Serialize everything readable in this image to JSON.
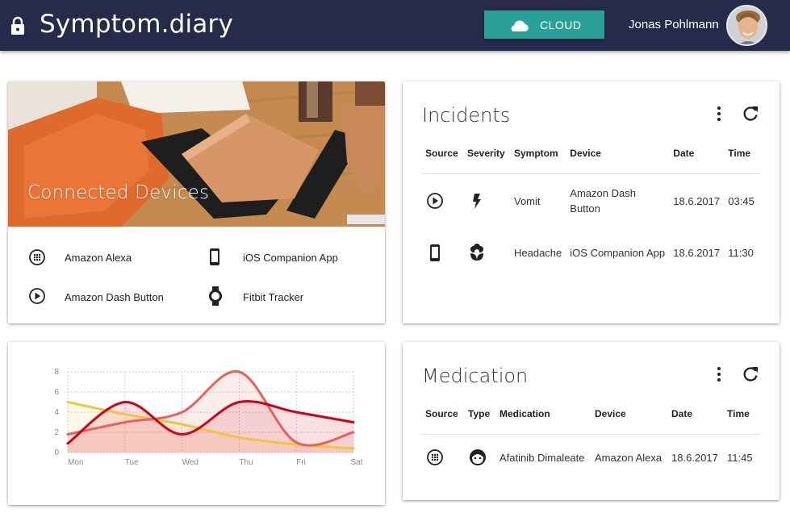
{
  "header": {
    "title": "Symptom.diary",
    "cloud_label": "CLOUD",
    "user_name": "Jonas Pohlmann",
    "bg_color": "#262b4a",
    "accent_color": "#2aa198"
  },
  "devices": {
    "title": "Connected Devices",
    "items": [
      {
        "label": "Amazon Alexa",
        "icon": "alexa-dots-icon"
      },
      {
        "label": "iOS Companion App",
        "icon": "phone-icon"
      },
      {
        "label": "Amazon Dash Button",
        "icon": "play-circle-icon"
      },
      {
        "label": "Fitbit Tracker",
        "icon": "watch-icon"
      }
    ]
  },
  "incidents": {
    "title": "Incidents",
    "columns": [
      "Source",
      "Severity",
      "Symptom",
      "Device",
      "Date",
      "Time"
    ],
    "rows": [
      {
        "source_icon": "play-circle-icon",
        "severity_icon": "lightning-icon",
        "symptom": "Vomit",
        "device": "Amazon Dash Button",
        "date": "18.6.2017",
        "time": "03:45"
      },
      {
        "source_icon": "phone-icon",
        "severity_icon": "flower-icon",
        "symptom": "Headache",
        "device": "iOS Companion App",
        "date": "18.6.2017",
        "time": "11:30"
      }
    ]
  },
  "medication": {
    "title": "Medication",
    "columns": [
      "Source",
      "Type",
      "Medication",
      "Device",
      "Date",
      "Time"
    ],
    "rows": [
      {
        "source_icon": "alexa-dots-icon",
        "type_icon": "face-icon",
        "medication": "Afatinib Dimaleate",
        "device": "Amazon Alexa",
        "date": "18.6.2017",
        "time": "11:45"
      }
    ]
  },
  "chart_data": {
    "type": "area",
    "categories": [
      "Mon",
      "Tue",
      "Wed",
      "Thu",
      "Fri",
      "Sat"
    ],
    "ylim": [
      0,
      8
    ],
    "yticks": [
      "0",
      "2",
      "4",
      "6",
      "8"
    ],
    "grid": true,
    "series": [
      {
        "color": "#d0021b",
        "values": [
          0.9,
          5.0,
          1.8,
          5.0,
          4.0,
          3.0
        ]
      },
      {
        "color": "#e8615a",
        "values": [
          1.8,
          3.0,
          4.0,
          8.0,
          1.0,
          2.0
        ]
      },
      {
        "color": "#f5c342",
        "values": [
          5.0,
          3.8,
          2.8,
          1.5,
          0.8,
          0.4
        ]
      }
    ]
  }
}
